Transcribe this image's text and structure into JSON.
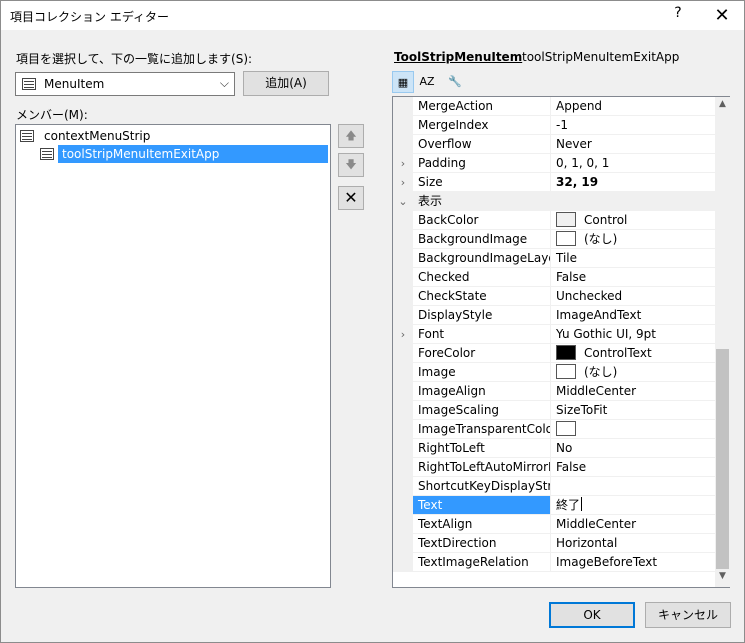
{
  "window": {
    "title": "項目コレクション エディター",
    "help": "?",
    "close": "✕"
  },
  "left": {
    "select_prompt": "項目を選択して、下の一覧に追加します(S):",
    "type_value": "MenuItem",
    "add_button": "追加(A)",
    "members_label": "メンバー(M):",
    "tree": [
      {
        "label": "contextMenuStrip",
        "level": 0,
        "selected": false
      },
      {
        "label": "toolStripMenuItemExitApp",
        "level": 1,
        "selected": true
      }
    ],
    "up_arrow": "🡅",
    "down_arrow": "🡇",
    "delete": "✕"
  },
  "props": {
    "type_name": "ToolStripMenuItem",
    "object_name": "toolStripMenuItemExitApp",
    "rows": [
      {
        "name": "MergeAction",
        "value": "Append"
      },
      {
        "name": "MergeIndex",
        "value": "-1"
      },
      {
        "name": "Overflow",
        "value": "Never"
      },
      {
        "name": "Padding",
        "value": "0, 1, 0, 1",
        "expander": "›"
      },
      {
        "name": "Size",
        "value": "32, 19",
        "expander": "›",
        "bold": true
      },
      {
        "name": "表示",
        "value": "",
        "expander": "⌄",
        "category": true
      },
      {
        "name": "BackColor",
        "value": "Control",
        "swatch": "#f0f0f0"
      },
      {
        "name": "BackgroundImage",
        "value": "(なし)",
        "swatch": "#ffffff"
      },
      {
        "name": "BackgroundImageLayout",
        "value": "Tile"
      },
      {
        "name": "Checked",
        "value": "False"
      },
      {
        "name": "CheckState",
        "value": "Unchecked"
      },
      {
        "name": "DisplayStyle",
        "value": "ImageAndText"
      },
      {
        "name": "Font",
        "value": "Yu Gothic UI, 9pt",
        "expander": "›"
      },
      {
        "name": "ForeColor",
        "value": "ControlText",
        "swatch": "#000000"
      },
      {
        "name": "Image",
        "value": "(なし)",
        "swatch": "#ffffff"
      },
      {
        "name": "ImageAlign",
        "value": "MiddleCenter"
      },
      {
        "name": "ImageScaling",
        "value": "SizeToFit"
      },
      {
        "name": "ImageTransparentColor",
        "value": "",
        "swatch": "#ffffff"
      },
      {
        "name": "RightToLeft",
        "value": "No"
      },
      {
        "name": "RightToLeftAutoMirrorIma",
        "value": "False"
      },
      {
        "name": "ShortcutKeyDisplayString",
        "value": ""
      },
      {
        "name": "Text",
        "value": "終了",
        "selected": true
      },
      {
        "name": "TextAlign",
        "value": "MiddleCenter"
      },
      {
        "name": "TextDirection",
        "value": "Horizontal"
      },
      {
        "name": "TextImageRelation",
        "value": "ImageBeforeText"
      }
    ]
  },
  "footer": {
    "ok": "OK",
    "cancel": "キャンセル"
  }
}
